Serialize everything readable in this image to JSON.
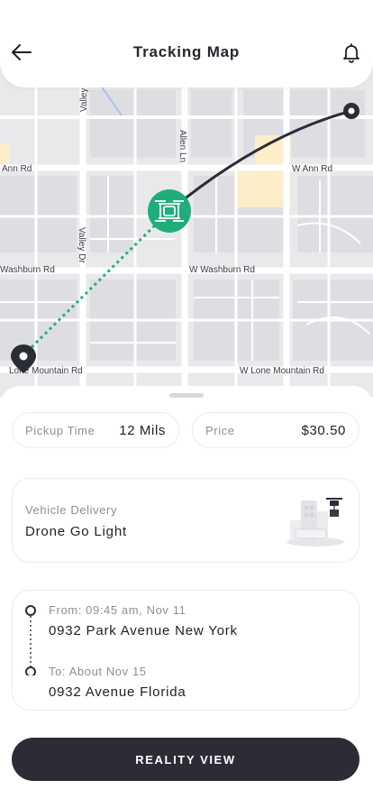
{
  "header": {
    "title": "Tracking Map"
  },
  "map": {
    "street_labels": {
      "valley_top": "Valley",
      "allen": "Allen Ln",
      "ann_west": "Ann Rd",
      "ann_east": "W Ann Rd",
      "valley_dr": "Valley Dr",
      "washburn_west": "Washburn Rd",
      "washburn_east": "W Washburn Rd",
      "lone_west": "Lone Mountain Rd",
      "lone_east": "W Lone Mountain Rd"
    },
    "colors": {
      "route_done": "#2b2d35",
      "route_pending": "#1fae7a",
      "drone_marker": "#1fae7a"
    }
  },
  "summary": {
    "pickup_label": "Pickup Time",
    "pickup_value": "12 Mils",
    "price_label": "Price",
    "price_value": "$30.50"
  },
  "vehicle": {
    "label": "Vehicle Delivery",
    "name": "Drone Go Light"
  },
  "route": {
    "from_label": "From: 09:45 am, Nov 11",
    "from_address": "0932 Park Avenue New York",
    "to_label": "To: About Nov 15",
    "to_address": "0932 Avenue Florida"
  },
  "cta": {
    "label": "REALITY VIEW"
  }
}
